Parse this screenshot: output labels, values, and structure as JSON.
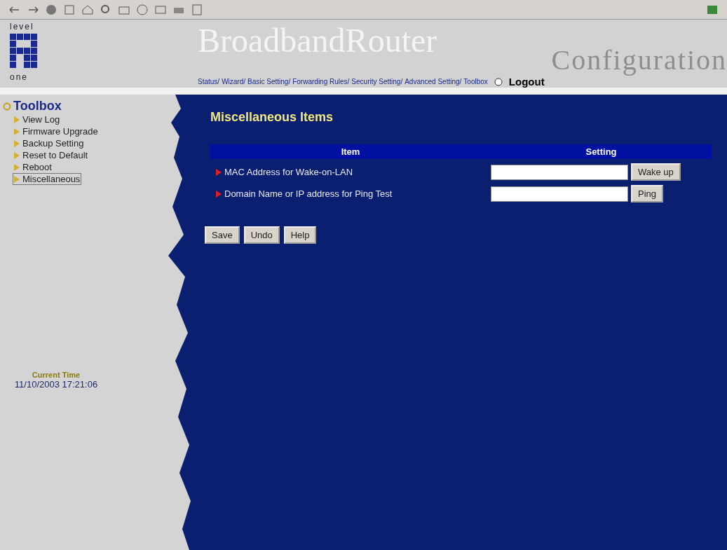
{
  "logo": {
    "top": "level",
    "bottom": "one"
  },
  "header": {
    "title": "BroadbandRouter",
    "subtitle": "Configuration"
  },
  "nav_links": [
    "Status/",
    "Wizard/",
    "Basic Setting/",
    "Forwarding Rules/",
    "Security Setting/",
    "Advanced Setting/",
    "Toolbox"
  ],
  "logout": {
    "label": "Logout"
  },
  "sidebar": {
    "title": "Toolbox",
    "items": [
      {
        "label": "View Log",
        "selected": false
      },
      {
        "label": "Firmware Upgrade",
        "selected": false
      },
      {
        "label": "Backup Setting",
        "selected": false
      },
      {
        "label": "Reset to Default",
        "selected": false
      },
      {
        "label": "Reboot",
        "selected": false
      },
      {
        "label": "Miscellaneous",
        "selected": true
      }
    ],
    "time_label": "Current Time",
    "time": "11/10/2003 17:21:06"
  },
  "main": {
    "heading": "Miscellaneous Items",
    "columns": [
      "Item",
      "Setting"
    ],
    "rows": [
      {
        "label": "MAC Address for Wake-on-LAN",
        "button": "Wake up"
      },
      {
        "label": "Domain Name or IP address for Ping Test",
        "button": "Ping"
      }
    ],
    "buttons": [
      "Save",
      "Undo",
      "Help"
    ]
  }
}
